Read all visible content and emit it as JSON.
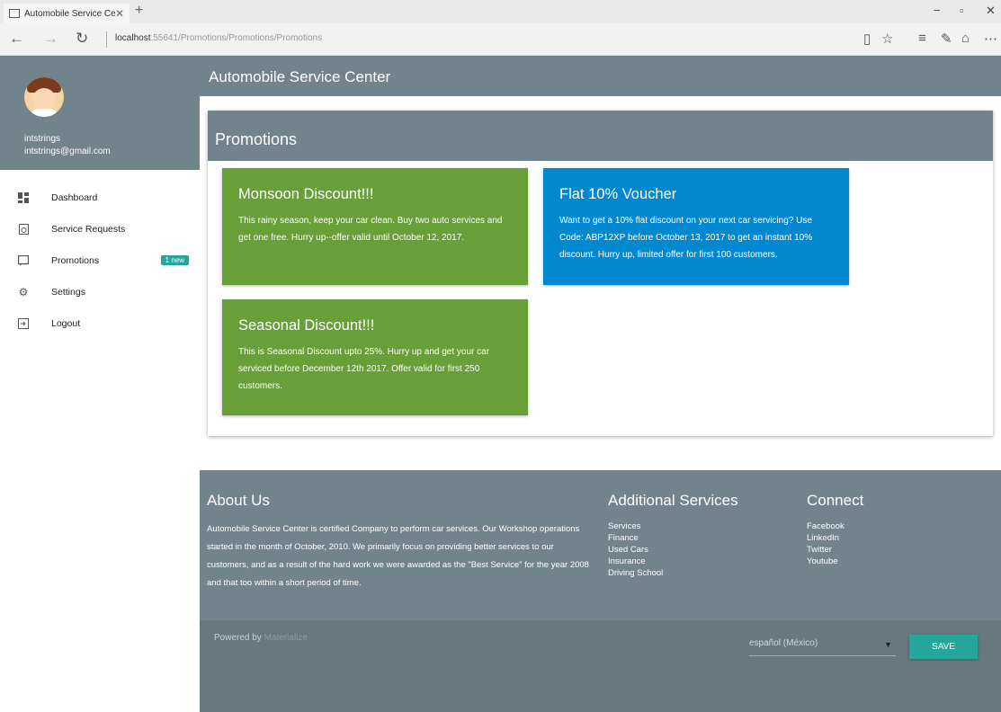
{
  "browser": {
    "tab_title": "Automobile Service Cen",
    "tab_close": "✕",
    "new_tab": "+",
    "url_host": "localhost",
    "url_path": ":55641/Promotions/Promotions/Promotions",
    "controls": {
      "minimize": "−",
      "maximize": "▫",
      "close": "✕"
    }
  },
  "sidebar": {
    "user_name": "intstrings",
    "user_email": "intstrings@gmail.com",
    "items": [
      {
        "label": "Dashboard",
        "icon": "dashboard-icon"
      },
      {
        "label": "Service Requests",
        "icon": "service-icon"
      },
      {
        "label": "Promotions",
        "icon": "promotions-icon",
        "badge": "1 new"
      },
      {
        "label": "Settings",
        "icon": "gear-icon"
      },
      {
        "label": "Logout",
        "icon": "logout-icon"
      }
    ]
  },
  "header": {
    "title": "Automobile Service Center"
  },
  "promotions": {
    "title": "Promotions",
    "cards": [
      {
        "title": "Monsoon Discount!!!",
        "text": "This rainy season, keep your car clean. Buy two auto services and get one free. Hurry up--offer valid until October 12, 2017.",
        "color": "#689f38"
      },
      {
        "title": "Flat 10% Voucher",
        "text": "Want to get a 10% flat discount on your next car servicing? Use Code: ABP12XP before October 13, 2017 to get an instant 10% discount. Hurry up, limited offer for first 100 customers.",
        "color": "#0288d1"
      },
      {
        "title": "Seasonal Discount!!!",
        "text": "This is Seasonal Discount upto 25%. Hurry up and get your car serviced before December 12th 2017. Offer valid for first 250 customers.",
        "color": "#689f38"
      }
    ]
  },
  "footer": {
    "about_title": "About Us",
    "about_text": "Automobile Service Center is certified Company to perform car services. Our Workshop operations started in the month of October, 2010. We primarily focus on providing better services to our customers, and as a result of the hard work we were awarded as the \"Best Service\" for the year 2008 and that too within a short period of time.",
    "services_title": "Additional Services",
    "services": [
      "Services",
      "Finance",
      "Used Cars",
      "Insurance",
      "Driving School"
    ],
    "connect_title": "Connect",
    "connect": [
      "Facebook",
      "LinkedIn",
      "Twitter",
      "Youtube"
    ],
    "powered_by": "Powered by",
    "powered_link": "Materialize",
    "language": "español (México)",
    "save_label": "SAVE"
  },
  "colors": {
    "primary": "#71848c",
    "green": "#689f38",
    "blue": "#0288d1",
    "accent": "#26a69a"
  }
}
